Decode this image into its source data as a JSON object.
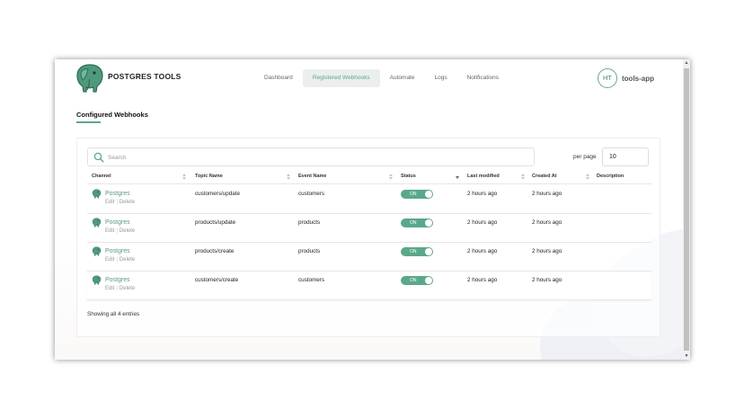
{
  "header": {
    "brand": "POSTGRES TOOLS",
    "nav": [
      "Dashboard",
      "Registered Webhooks",
      "Automate",
      "Logs",
      "Notifications"
    ],
    "active_nav": "Registered Webhooks",
    "avatar_initials": "HT",
    "account_name": "tools-app"
  },
  "page": {
    "title": "Configured Webhooks"
  },
  "search": {
    "placeholder": "Search",
    "value": ""
  },
  "per_page": {
    "label": "per page",
    "value": "10"
  },
  "table": {
    "columns": [
      "Channel",
      "Topic Name",
      "Event Name",
      "Status",
      "Last modified",
      "Created At",
      "Description"
    ],
    "sorted_column": "Status",
    "rows": [
      {
        "channel": "Postgres",
        "edit": "Edit",
        "delete": "Delete",
        "topic": "customers/update",
        "event": "customers",
        "status": "ON",
        "last_modified": "2 hours ago",
        "created_at": "2 hours ago",
        "description": ""
      },
      {
        "channel": "Postgres",
        "edit": "Edit",
        "delete": "Delete",
        "topic": "products/update",
        "event": "products",
        "status": "ON",
        "last_modified": "2 hours ago",
        "created_at": "2 hours ago",
        "description": ""
      },
      {
        "channel": "Postgres",
        "edit": "Edit",
        "delete": "Delete",
        "topic": "products/create",
        "event": "products",
        "status": "ON",
        "last_modified": "2 hours ago",
        "created_at": "2 hours ago",
        "description": ""
      },
      {
        "channel": "Postgres",
        "edit": "Edit",
        "delete": "Delete",
        "topic": "customers/create",
        "event": "customers",
        "status": "ON",
        "last_modified": "2 hours ago",
        "created_at": "2 hours ago",
        "description": ""
      }
    ]
  },
  "footer": {
    "entries_text": "Showing all 4 entries"
  },
  "icons": {
    "logo": "postgres-elephant-icon",
    "search": "search-icon",
    "channel": "postgres-elephant-icon"
  },
  "colors": {
    "accent": "#5aa88a",
    "nav_active_bg": "#eceeee",
    "text": "#222222"
  }
}
